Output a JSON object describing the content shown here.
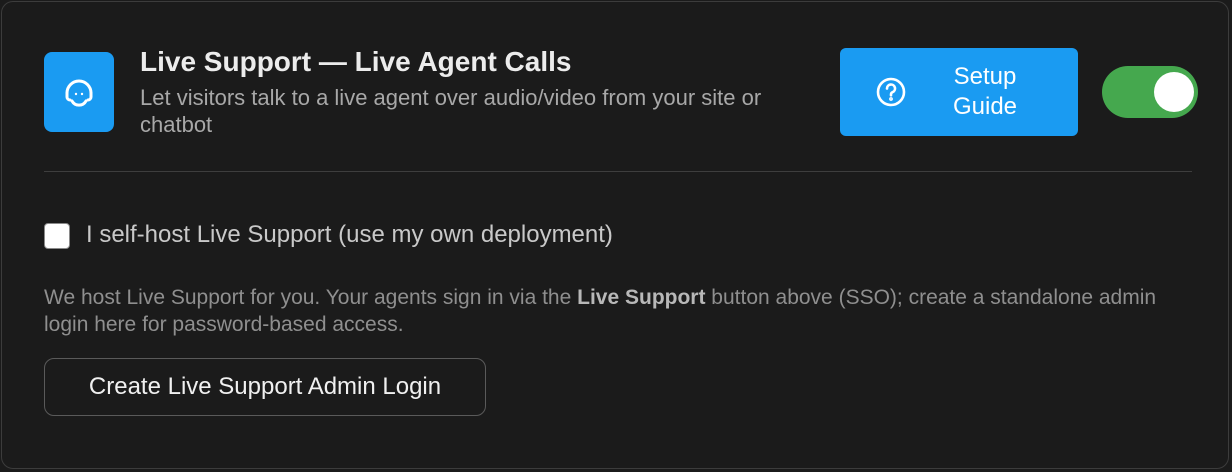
{
  "header": {
    "title": "Live Support — Live Agent Calls",
    "subtitle": "Let visitors talk to a live agent over audio/video from your site or chatbot",
    "app_icon": "headset-icon"
  },
  "setup_button": {
    "icon": "question-circle-icon",
    "label": "Setup Guide"
  },
  "enabled_toggle": {
    "on": true,
    "color": "#45a84e"
  },
  "self_host": {
    "checked": false,
    "label": "I self-host Live Support (use my own deployment)"
  },
  "help": {
    "text_before": "We host Live Support for you. Your agents sign in via the ",
    "bold": "Live Support",
    "text_after": " button above (SSO); create a standalone admin login here for password-based access."
  },
  "admin_button": {
    "label": "Create Live Support Admin Login"
  },
  "colors": {
    "accent": "#1a9bf2",
    "background": "#1b1b1b",
    "toggle_on": "#45a84e"
  }
}
